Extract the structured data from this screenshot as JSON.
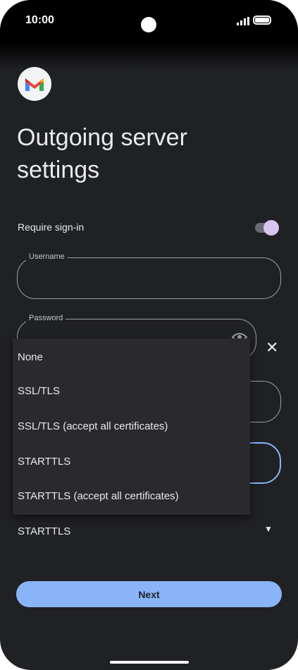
{
  "status": {
    "time": "10:00"
  },
  "page": {
    "title": "Outgoing server settings",
    "require_label": "Require sign-in"
  },
  "fields": {
    "username_label": "Username",
    "password_label": "Password"
  },
  "menu": {
    "options": [
      "None",
      "SSL/TLS",
      "SSL/TLS (accept all certificates)",
      "STARTTLS",
      "STARTTLS (accept all certificates)"
    ]
  },
  "security": {
    "selected": "STARTTLS"
  },
  "actions": {
    "next_label": "Next"
  },
  "icons": {
    "logo": "gmail-icon",
    "eye": "eye-icon",
    "clear": "close-icon",
    "dropdown": "dropdown-arrow-icon"
  },
  "colors": {
    "accent": "#8ab4f8",
    "toggle_thumb": "#d8c5ef",
    "background": "#202124"
  }
}
